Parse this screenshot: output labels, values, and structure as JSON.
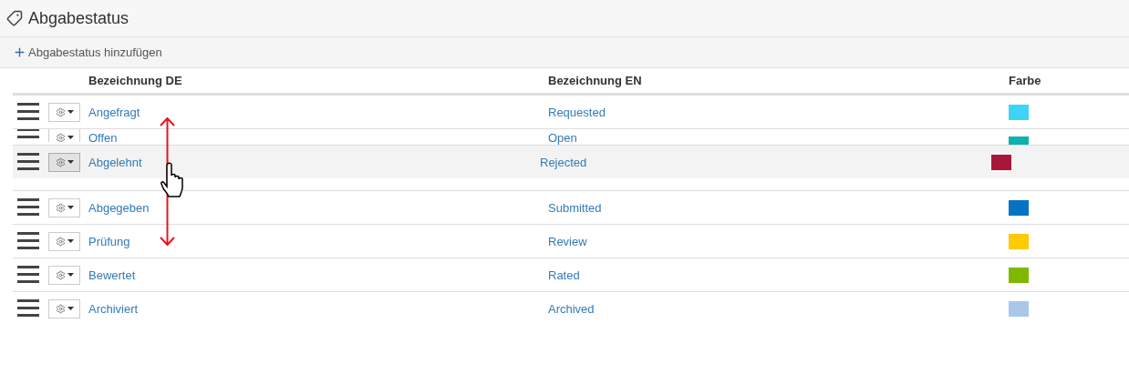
{
  "title": "Abgabestatus",
  "add_button": "Abgabestatus hinzufügen",
  "columns": [
    "Bezeichnung DE",
    "Bezeichnung EN",
    "Farbe"
  ],
  "rows": [
    {
      "kind": "normal",
      "de": "Angefragt",
      "en": "Requested",
      "color": "#3ed3f7"
    },
    {
      "kind": "partly_hidden",
      "de": "Offen",
      "en": "Open",
      "color": "#0eb2ac"
    },
    {
      "kind": "dragged",
      "de": "Abgelehnt",
      "en": "Rejected",
      "color": "#a8163a"
    },
    {
      "kind": "normal",
      "de": "Abgegeben",
      "en": "Submitted",
      "color": "#0572c4"
    },
    {
      "kind": "normal",
      "de": "Prüfung",
      "en": "Review",
      "color": "#fccb00"
    },
    {
      "kind": "normal",
      "de": "Bewertet",
      "en": "Rated",
      "color": "#7fb800"
    },
    {
      "kind": "normal",
      "de": "Archiviert",
      "en": "Archived",
      "color": "#a9c8e8"
    }
  ]
}
